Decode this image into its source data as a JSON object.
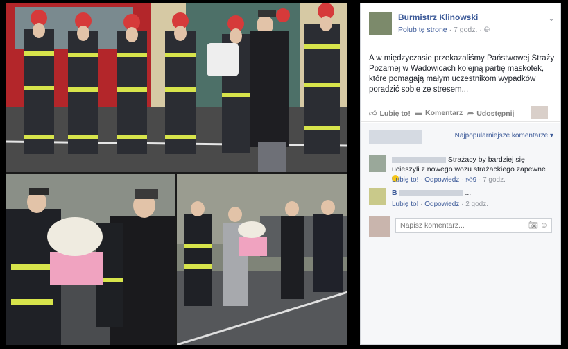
{
  "post": {
    "page_name": "Burmistrz Klinowski",
    "follow_label": "Polub tę stronę",
    "time": "7 godz.",
    "privacy_icon": "globe-icon",
    "text": "A w międzyczasie przekazaliśmy Państwowej Straży Pożarnej w Wadowicach kolejną partię maskotek, które pomagają małym uczestnikom wypadków poradzić sobie ze stresem..."
  },
  "actions": {
    "like": "Lubię to!",
    "comment": "Komentarz",
    "share": "Udostępnij"
  },
  "comments_section": {
    "sort_label": "Najpopularniejsze komentarze"
  },
  "comments": [
    {
      "text": "Strażacy by bardziej się ucieszyli z nowego wozu strażackiego zapewne",
      "like": "Lubię to!",
      "reply": "Odpowiedz",
      "likes": "9",
      "time": "7 godz."
    },
    {
      "name_start": "B",
      "text": "...",
      "like": "Lubię to!",
      "reply": "Odpowiedz",
      "time": "2 godz."
    }
  ],
  "composer": {
    "placeholder": "Napisz komentarz..."
  },
  "colors": {
    "link": "#3b5998",
    "meta": "#90949c",
    "background": "#000000"
  }
}
